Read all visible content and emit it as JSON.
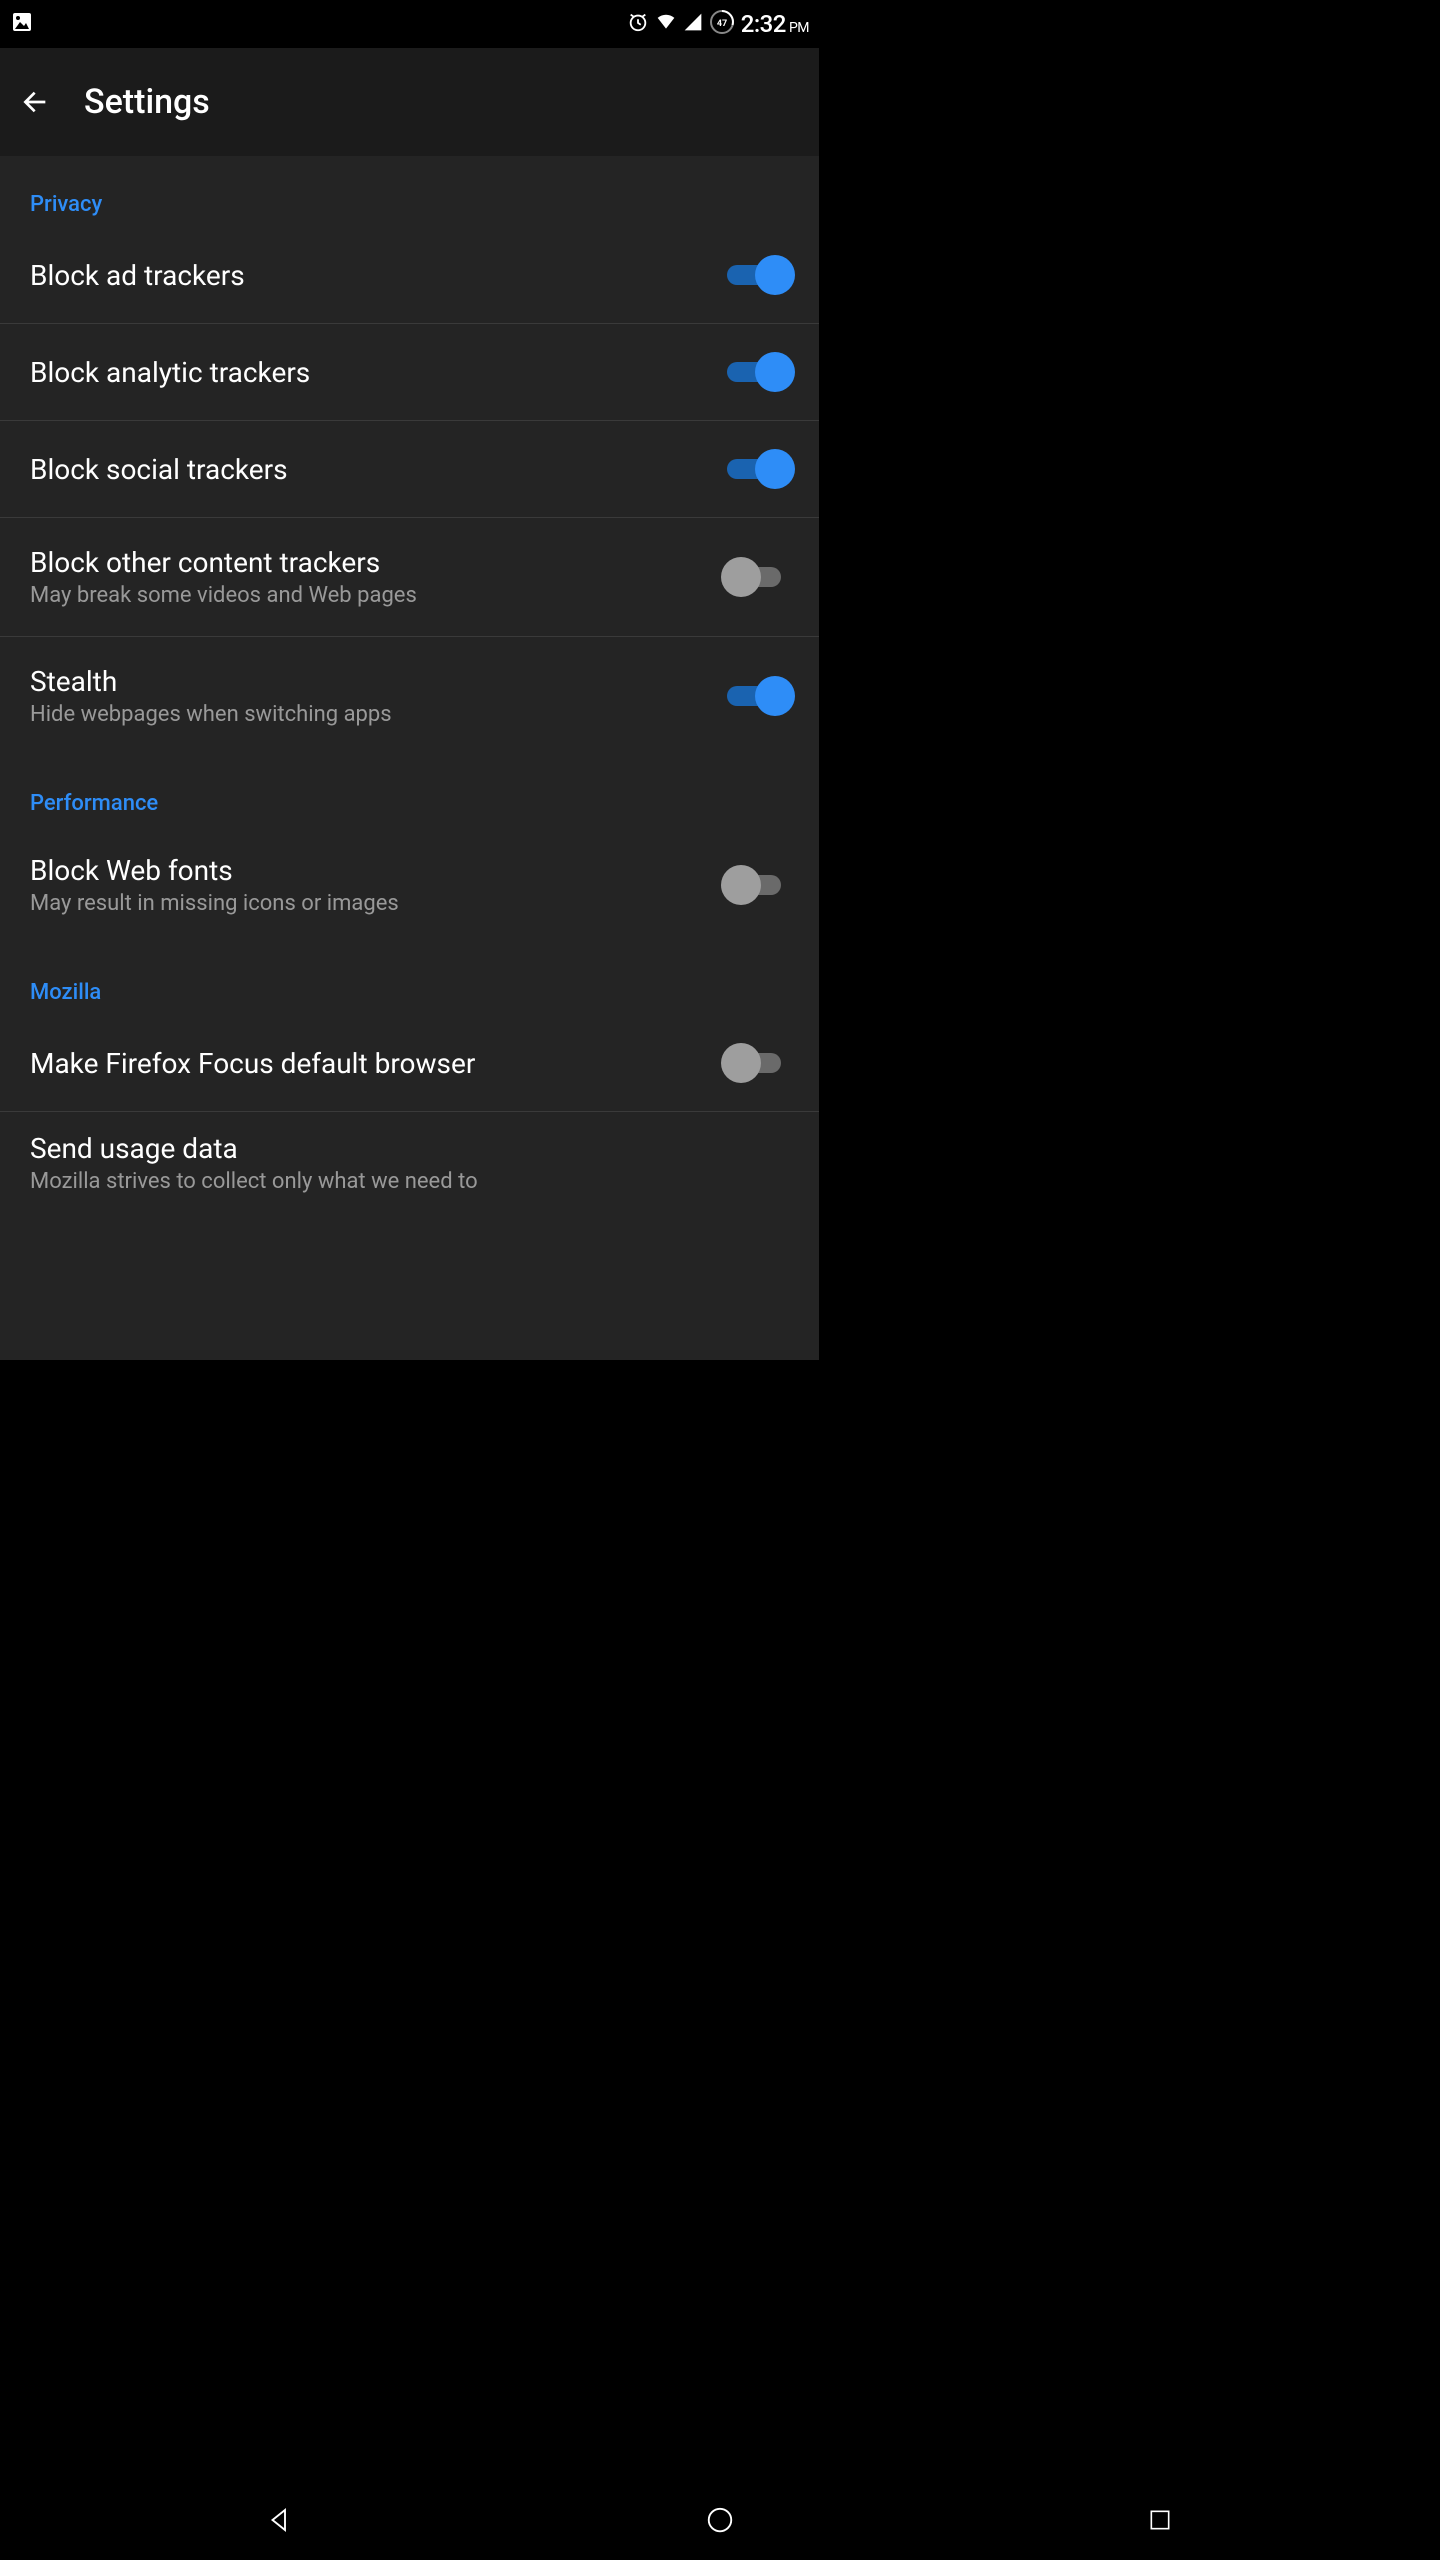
{
  "statusBar": {
    "time": "2:32",
    "ampm": "PM",
    "batteryLevel": "47"
  },
  "appBar": {
    "title": "Settings"
  },
  "sections": {
    "privacy": {
      "header": "Privacy",
      "blockAdTrackers": {
        "label": "Block ad trackers",
        "on": true
      },
      "blockAnalyticTrackers": {
        "label": "Block analytic trackers",
        "on": true
      },
      "blockSocialTrackers": {
        "label": "Block social trackers",
        "on": true
      },
      "blockOtherContent": {
        "label": "Block other content trackers",
        "sub": "May break some videos and Web pages",
        "on": false
      },
      "stealth": {
        "label": "Stealth",
        "sub": "Hide webpages when switching apps",
        "on": true
      }
    },
    "performance": {
      "header": "Performance",
      "blockWebFonts": {
        "label": "Block Web fonts",
        "sub": "May result in missing icons or images",
        "on": false
      }
    },
    "mozilla": {
      "header": "Mozilla",
      "defaultBrowser": {
        "label": "Make Firefox Focus default browser",
        "on": false
      },
      "sendUsageData": {
        "label": "Send usage data",
        "sub": "Mozilla strives to collect only what we need to",
        "on": true
      }
    }
  }
}
